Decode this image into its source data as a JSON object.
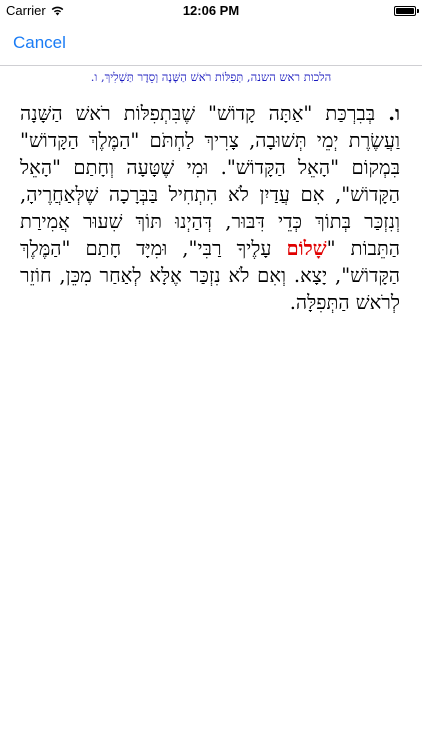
{
  "status_bar": {
    "carrier": "Carrier",
    "time": "12:06 PM",
    "wifi_icon": "wifi-icon",
    "battery_icon": "battery-icon",
    "battery_level": 1.0
  },
  "nav": {
    "cancel_label": "Cancel"
  },
  "breadcrumb": "הלכות ראש השנה, תְּפִלּוֹת רֹאשׁ הַשָּׁנָה וְסֵדֶר תַּשְׁלִיךְ, ו.",
  "paragraph": {
    "number": "ו.",
    "text_before": "בְּבִרְכַּת \"אַתָּה קָדוֹשׁ\" שֶׁבִּתְפִלּוֹת רֹאשׁ הַשָּׁנָה וַעֲשֶׂרֶת יְמֵי תְּשׁוּבָה, צָרִיךְ לַחְתֹּם \"הַמֶּלֶךְ הַקָּדוֹשׁ\" בִּמְקוֹם \"הָאֵל הַקָּדוֹשׁ\". וּמִי שֶׁטָּעָה וְחָתַם \"הָאֵל הַקָּדוֹשׁ\", אִם עֲדַיִן לֹא הִתְחִיל בַּבְּרָכָה שֶׁלְּאַחֲרֶיהָ, וְנִזְכַּר בְּתוֹךְ כְּדֵי דִּבּוּר, דְּהַיְנוּ תּוֹךְ שִׁעוּר אֲמִירַת הַתֵּבוֹת \"",
    "highlight": "שָׁלוֹם",
    "text_after": " עָלֶיךָ רַבִּי\", וּמִיָּד חָתַם \"הַמֶּלֶךְ הַקָּדוֹשׁ\", יָצָא. וְאִם לֹא נִזְכַּר אֶלָּא לְאַחַר מִכֵּן, חוֹזֵר לְרֹאשׁ הַתְּפִלָּה.",
    "highlight_color": "#e00000"
  },
  "colors": {
    "accent": "#1a7cf5",
    "breadcrumb": "#1b1bbf"
  }
}
